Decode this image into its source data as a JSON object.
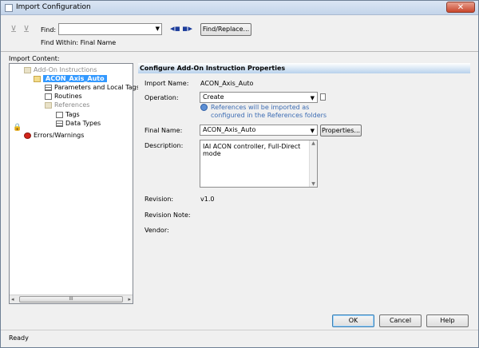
{
  "window": {
    "title": "Import Configuration",
    "close_glyph": "✕"
  },
  "toolbar": {
    "find_label": "Find:",
    "find_value": "",
    "find_within": "Find Within: Final Name",
    "find_replace_label": "Find/Replace..."
  },
  "tree": {
    "label": "Import Content:",
    "items": [
      {
        "label": "Add-On Instructions"
      },
      {
        "label": "ACON_Axis_Auto"
      },
      {
        "label": "Parameters and Local Tags"
      },
      {
        "label": "Routines"
      },
      {
        "label": "References"
      },
      {
        "label": "Tags"
      },
      {
        "label": "Data Types"
      },
      {
        "label": "Errors/Warnings"
      }
    ],
    "scroll_thumb": "III"
  },
  "props": {
    "header": "Configure Add-On Instruction Properties",
    "import_name_label": "Import Name:",
    "import_name": "ACON_Axis_Auto",
    "operation_label": "Operation:",
    "operation": "Create",
    "note_line1": "References will be imported as",
    "note_line2": "configured in the References folders",
    "final_name_label": "Final Name:",
    "final_name": "ACON_Axis_Auto",
    "properties_label": "Properties...",
    "description_label": "Description:",
    "description": "IAI ACON controller, Full-Direct mode",
    "revision_label": "Revision:",
    "revision": "v1.0",
    "revision_note_label": "Revision Note:",
    "vendor_label": "Vendor:"
  },
  "buttons": {
    "ok": "OK",
    "cancel": "Cancel",
    "help": "Help"
  },
  "status": "Ready"
}
